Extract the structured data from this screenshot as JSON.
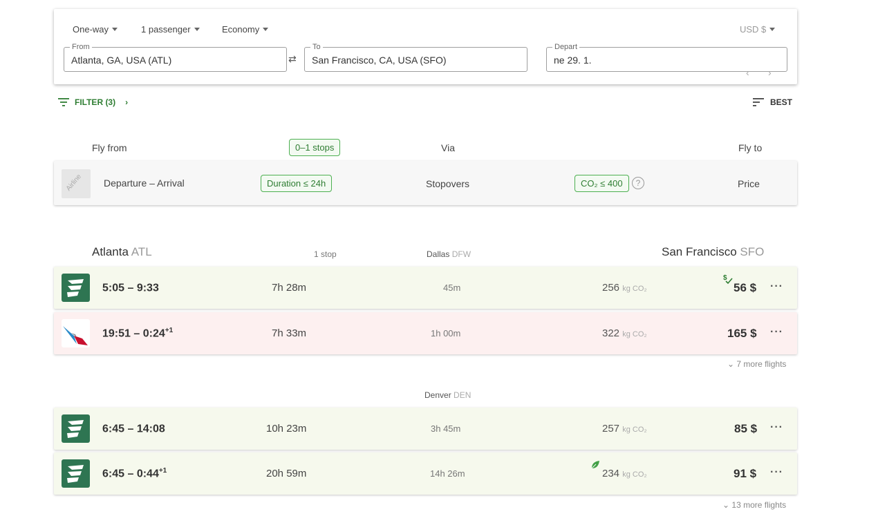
{
  "search": {
    "trip_type": "One-way",
    "passengers": "1 passenger",
    "cabin": "Economy",
    "currency": "USD $",
    "from_label": "From",
    "from_value": "Atlanta, GA, USA (ATL)",
    "to_label": "To",
    "to_value": "San Francisco, CA, USA (SFO)",
    "depart_label": "Depart",
    "depart_value": "ne 29. 1."
  },
  "toolbar": {
    "filter_label": "FILTER (3)",
    "sort_label": "BEST"
  },
  "legend": {
    "fly_from": "Fly from",
    "stops_chip": "0–1 stops",
    "via": "Via",
    "fly_to": "Fly to",
    "airline_placeholder": "Airline",
    "departure_arrival": "Departure – Arrival",
    "duration_chip": "Duration ≤ 24h",
    "stopovers": "Stopovers",
    "co2_chip": "CO₂ ≤ 400",
    "help": "?",
    "price": "Price"
  },
  "results": {
    "origin_city": "Atlanta",
    "origin_code": "ATL",
    "stops_text": "1 stop",
    "dest_city": "San Francisco",
    "dest_code": "SFO",
    "co2_unit": "kg CO₂",
    "groups": [
      {
        "via_city": "Dallas",
        "via_code": "DFW",
        "more_flights": "7 more flights",
        "flights": [
          {
            "airline_icon": "frontier-logo",
            "time": "5:05 – 9:33",
            "day_offset": "",
            "duration": "7h 28m",
            "stopover": "45m",
            "co2": "256",
            "price": "56 $",
            "badge": "cheapest-dollar-check-icon"
          },
          {
            "airline_icon": "american-airlines-logo",
            "time": "19:51 – 0:24",
            "day_offset": "+1",
            "duration": "7h 33m",
            "stopover": "1h 00m",
            "co2": "322",
            "price": "165 $",
            "badge": ""
          }
        ]
      },
      {
        "via_city": "Denver",
        "via_code": "DEN",
        "more_flights": "13 more flights",
        "flights": [
          {
            "airline_icon": "frontier-logo",
            "time": "6:45 – 14:08",
            "day_offset": "",
            "duration": "10h 23m",
            "stopover": "3h 45m",
            "co2": "257",
            "price": "85 $",
            "badge": ""
          },
          {
            "airline_icon": "frontier-logo",
            "time": "6:45 – 0:44",
            "day_offset": "+1",
            "duration": "20h 59m",
            "stopover": "14h 26m",
            "co2": "234",
            "price": "91 $",
            "badge": "leaf-icon"
          }
        ]
      }
    ]
  },
  "colors": {
    "accent_green": "#2e7d32",
    "row_green": "#f6f9ed",
    "row_red": "#fdf0f0",
    "frontier_green": "#2e7552"
  }
}
